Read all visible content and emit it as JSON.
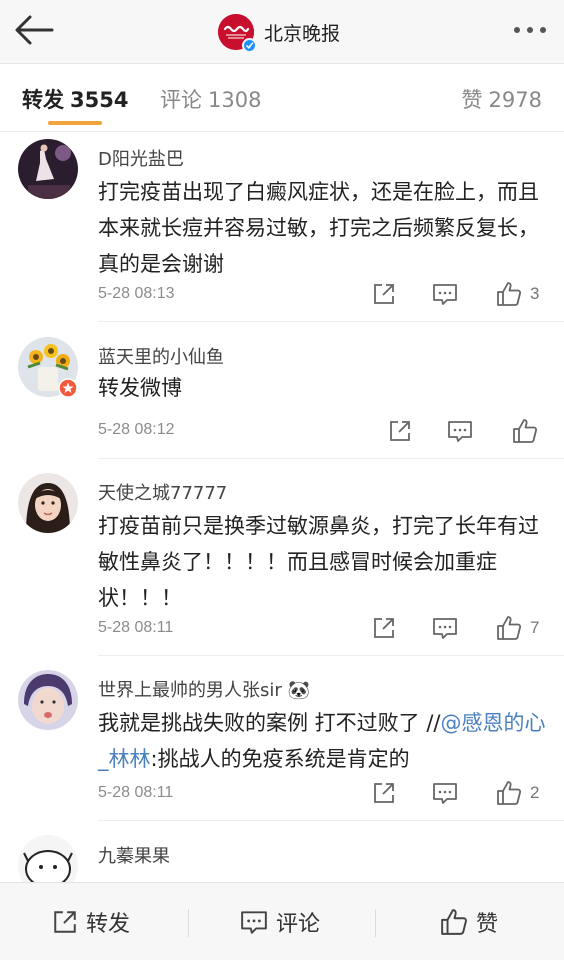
{
  "header": {
    "back_icon": "arrow-left-icon",
    "logo_text": "北京晚报",
    "title": "北京晚报",
    "more_icon": "ellipsis-icon",
    "verified_color": "#1e90ff",
    "logo_color": "#c8102e"
  },
  "tabs": {
    "repost_label": "转发",
    "repost_count": "3554",
    "comment_label": "评论",
    "comment_count": "1308",
    "like_label": "赞",
    "like_count": "2978",
    "active_tab": "repost",
    "underline_color": "#f2a33c"
  },
  "comments": [
    {
      "user": "D阳光盐巴",
      "content": "打完疫苗出现了白癜风症状，还是在脸上，而且本来就长痘并容易过敏，打完之后频繁反复长，真的是会谢谢",
      "time": "5-28 08:13",
      "likes": "3"
    },
    {
      "user": "蓝天里的小仙鱼",
      "content": "转发微博",
      "time": "5-28 08:12",
      "likes": ""
    },
    {
      "user": "天使之城77777",
      "content": "打疫苗前只是换季过敏源鼻炎，打完了长年有过敏性鼻炎了！！！！而且感冒时候会加重症状！！！",
      "time": "5-28 08:11",
      "likes": "7"
    },
    {
      "user": "世界上最帅的男人张sir",
      "user_emoji": "🐼",
      "content_before": "我就是挑战失败的案例 打不过败了 //",
      "mention": "@感恩的心_林林",
      "content_after": ":挑战人的免疫系统是肯定的",
      "time": "5-28 08:11",
      "likes": "2"
    },
    {
      "user": "九蓁果果"
    }
  ],
  "bottom_bar": {
    "repost_label": "转发",
    "comment_label": "评论",
    "like_label": "赞"
  }
}
